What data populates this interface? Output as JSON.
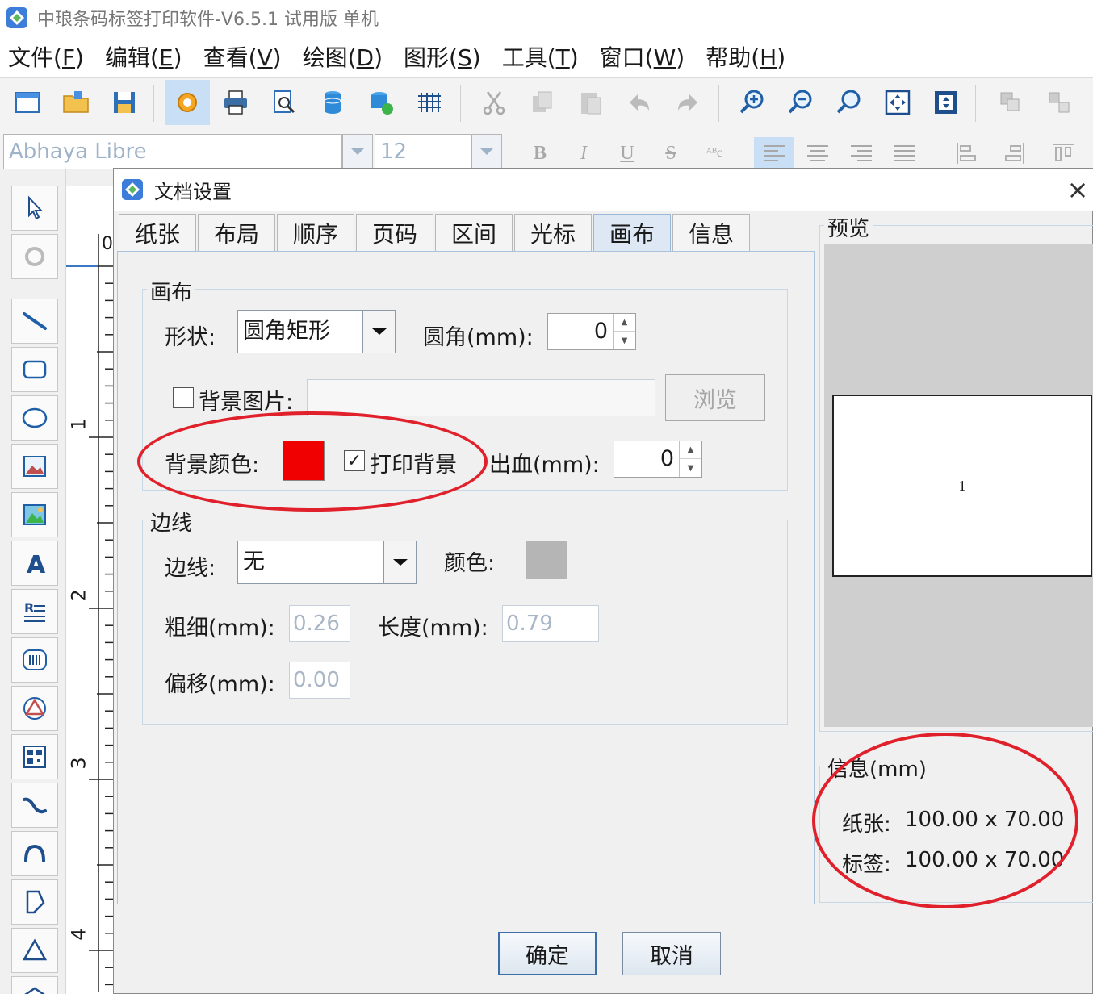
{
  "window": {
    "title": "中琅条码标签打印软件-V6.5.1 试用版 单机"
  },
  "menu": [
    {
      "label": "文件(",
      "key": "F",
      "end": ")"
    },
    {
      "label": "编辑(",
      "key": "E",
      "end": ")"
    },
    {
      "label": "查看(",
      "key": "V",
      "end": ")"
    },
    {
      "label": "绘图(",
      "key": "D",
      "end": ")"
    },
    {
      "label": "图形(",
      "key": "S",
      "end": ")"
    },
    {
      "label": "工具(",
      "key": "T",
      "end": ")"
    },
    {
      "label": "窗口(",
      "key": "W",
      "end": ")"
    },
    {
      "label": "帮助(",
      "key": "H",
      "end": ")"
    }
  ],
  "format": {
    "font": "Abhaya Libre",
    "size": "12",
    "bold": "B",
    "italic": "I",
    "underline": "U",
    "strike": "S",
    "superscript": "ᴬᴮc"
  },
  "ruler": {
    "zero": "0",
    "ticks": [
      "1",
      "2",
      "3",
      "4"
    ]
  },
  "dialog": {
    "title": "文档设置",
    "close": "×",
    "tabs": [
      "纸张",
      "布局",
      "顺序",
      "页码",
      "区间",
      "光标",
      "画布",
      "信息"
    ],
    "active_tab": "画布",
    "canvas": {
      "legend": "画布",
      "shape_label": "形状:",
      "shape_value": "圆角矩形",
      "radius_label": "圆角(mm):",
      "radius_value": "0",
      "bg_image_label": "背景图片:",
      "bg_image_checked": false,
      "browse": "浏览",
      "bg_color_label": "背景颜色:",
      "bg_color": "#f00000",
      "print_bg_label": "打印背景",
      "print_bg_checked": true,
      "print_bg_mark": "✓",
      "bleed_label": "出血(mm):",
      "bleed_value": "0"
    },
    "border": {
      "legend": "边线",
      "line_label": "边线:",
      "line_value": "无",
      "color_label": "颜色:",
      "color": "#b5b5b5",
      "width_label": "粗细(mm):",
      "width_value": "0.26",
      "length_label": "长度(mm):",
      "length_value": "0.79",
      "offset_label": "偏移(mm):",
      "offset_value": "0.00"
    },
    "preview": {
      "legend": "预览",
      "page_number": "1"
    },
    "info": {
      "legend": "信息(mm)",
      "paper_label": "纸张:",
      "paper_value": "100.00 x 70.00",
      "label_label": "标签:",
      "label_value": "100.00 x 70.00"
    },
    "ok": "确定",
    "cancel": "取消"
  },
  "accent": {
    "annotation": "#e0202a",
    "selection": "#c9dff5"
  }
}
